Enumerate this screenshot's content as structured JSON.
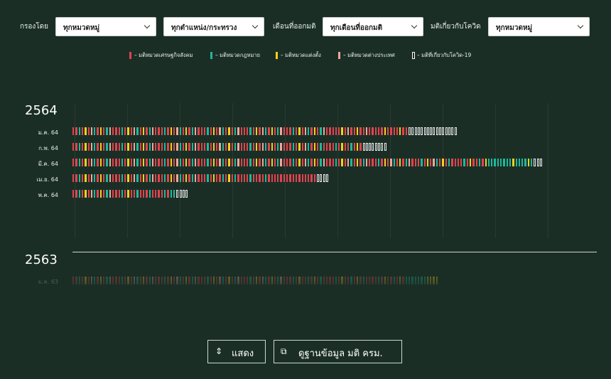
{
  "filters": [
    {
      "label": "กรองโดย",
      "value": "ทุกหมวดหมู่"
    },
    {
      "label": "",
      "value": "ทุกตำแหน่ง/กระทรวง"
    },
    {
      "label": "เดือนที่ออกมติ",
      "value": "ทุกเดือนที่ออกมติ"
    },
    {
      "label": "มติเกี่ยวกับโควิด",
      "value": "ทุกหมวดหมู่"
    }
  ],
  "legend": [
    {
      "label": "– มติหมวดเศรษฐกิจสังคม",
      "color": "#e0444e"
    },
    {
      "label": "– มติหมวดกฎหมาย",
      "color": "#1fb89a"
    },
    {
      "label": "– มติหมวดแต่งตั้ง",
      "color": "#f3d21a"
    },
    {
      "label": "– มติหมวดต่างประเทศ",
      "color": "#f0a89a"
    },
    {
      "label": "– มติที่เกี่ยวกับโควิด-19",
      "color": "#ffffff"
    }
  ],
  "colors": {
    "background": "#1b2e26",
    "econ": "#e0444e",
    "law": "#1fb89a",
    "appoint": "#f3d21a",
    "foreign": "#f0a89a"
  },
  "years": [
    {
      "year": "2564",
      "months": [
        {
          "label": "ม.ค. 64",
          "counts": {
            "econ": 62,
            "law": 18,
            "appoint": 16,
            "foreign": 14,
            "covid": 16
          }
        },
        {
          "label": "ก.พ. 64",
          "counts": {
            "econ": 50,
            "law": 20,
            "appoint": 14,
            "foreign": 11,
            "covid": 8
          }
        },
        {
          "label": "มี.ค. 64",
          "counts": {
            "econ": 70,
            "law": 42,
            "appoint": 22,
            "foreign": 17,
            "covid": 3
          }
        },
        {
          "label": "เม.ย. 64",
          "counts": {
            "econ": 52,
            "law": 14,
            "appoint": 8,
            "foreign": 6,
            "covid": 4
          }
        },
        {
          "label": "พ.ค. 64",
          "counts": {
            "econ": 20,
            "law": 9,
            "appoint": 3,
            "foreign": 2,
            "covid": 4
          }
        }
      ]
    },
    {
      "year": "2563",
      "months": [
        {
          "label": "ม.ค. 63",
          "counts": {
            "econ": 60,
            "law": 30,
            "appoint": 20,
            "foreign": 10,
            "covid": 0
          }
        }
      ]
    }
  ],
  "buttons": {
    "show": {
      "icon": "⌃⌄",
      "label": "แสดง"
    },
    "database": {
      "icon": "⇗",
      "label": "ดูฐานข้อมูล มติ ครม."
    }
  }
}
